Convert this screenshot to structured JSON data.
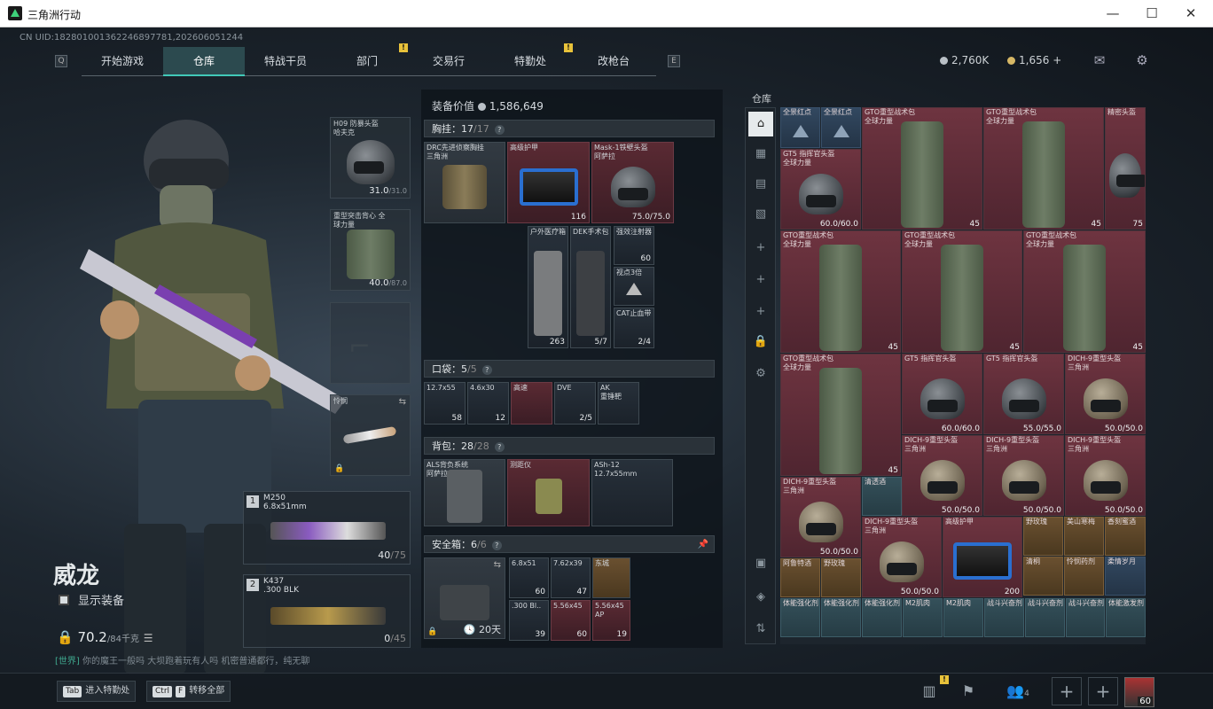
{
  "window": {
    "title": "三角洲行动",
    "minimize": "—",
    "maximize": "☐",
    "close": "✕"
  },
  "uid": "CN UID:1828010013622468977​81,20260605​1244",
  "nav": {
    "key_left": "Q",
    "key_right": "E",
    "tabs": [
      "开始游戏",
      "仓库",
      "特战干员",
      "部门",
      "交易行",
      "特勤处",
      "改枪台"
    ],
    "active": "仓库"
  },
  "currency": {
    "silver": "2,760K",
    "silver_color": "#b9c0c6",
    "gold": "1,656",
    "gold_plus": "+",
    "gold_color": "#d7b866"
  },
  "operator": {
    "name": "威龙",
    "show_equipment": "显示装备",
    "weight": "70.2",
    "weight_max": "/84千克"
  },
  "chat": {
    "channel": "[世界]",
    "text": "你的魔王一般吗 大坝跑着玩有人吗 机密普通都行，纯无聊"
  },
  "gear": {
    "helmet": {
      "label": "H09 防暴头盔 哈夫克",
      "durability": "31.0",
      "max": "/31.0"
    },
    "armor": {
      "label": "重型突击背心 全球力量",
      "durability": "40.0",
      "max": "/87.0"
    },
    "melee": {
      "label": "怜悯"
    },
    "primary": {
      "num": "1",
      "name": "M250",
      "caliber": "6.8x51mm",
      "ammo": "40",
      "ammo_max": "/75"
    },
    "secondary": {
      "num": "2",
      "name": "K437",
      "caliber": ".300 BLK",
      "ammo": "0",
      "ammo_max": "/45"
    }
  },
  "mid": {
    "value_label": "装备价值",
    "value": "1,586,649",
    "rig": {
      "label": "胸挂：",
      "count": "17",
      "max": "/17"
    },
    "pocket": {
      "label": "口袋：",
      "count": "5",
      "max": "/5"
    },
    "backpack": {
      "label": "背包：",
      "count": "28",
      "max": "/28"
    },
    "safe": {
      "label": "安全箱：",
      "count": "6",
      "max": "/6",
      "timer": "20天"
    },
    "rig_items": [
      {
        "label": "DRC先进侦察胸挂\n三角洲",
        "value": ""
      },
      {
        "label": "高级护甲",
        "value": "116"
      },
      {
        "label": "Mask-1铁壁头盔\n阿萨拉",
        "value": "75.0/75.0"
      },
      {
        "label": "户外医疗箱",
        "value": "263"
      },
      {
        "label": "DEK手术包",
        "value": "5/7"
      },
      {
        "label": "强效注射器",
        "value": "60"
      },
      {
        "label": "视点3倍",
        "value": ""
      },
      {
        "label": "CAT止血带",
        "value": "2/4"
      }
    ],
    "pocket_items": [
      {
        "label": "12.7x55",
        "value": "58"
      },
      {
        "label": "4.6x30",
        "value": "12"
      },
      {
        "label": "高速",
        "value": ""
      },
      {
        "label": "DVE",
        "value": "2/5"
      },
      {
        "label": "AK\n重锤靶",
        "value": ""
      }
    ],
    "backpack_items": [
      {
        "label": "ALS背负系统\n阿萨拉",
        "value": ""
      },
      {
        "label": "测距仪",
        "value": ""
      },
      {
        "label": "ASh-12\n12.7x55mm",
        "value": ""
      }
    ],
    "safe_items": [
      {
        "label": "6.8x51",
        "value": "60"
      },
      {
        "label": "7.62x39",
        "value": "47"
      },
      {
        "label": "东城",
        "value": ""
      },
      {
        "label": ".300 Bl..",
        "value": "39"
      },
      {
        "label": "5.56x45",
        "value": "60"
      },
      {
        "label": "5.56x45\nAP",
        "value": "19"
      }
    ]
  },
  "storage": {
    "title": "仓库",
    "sidebar": [
      "home-icon",
      "grid-icon",
      "box-icon",
      "gallery-icon",
      "plus-icon",
      "plus-icon",
      "plus-icon",
      "lock-icon",
      "gear-icon",
      "archive-icon",
      "layers-icon",
      "sort-icon"
    ],
    "items": [
      {
        "label": "全景红点",
        "value": ""
      },
      {
        "label": "全景红点",
        "value": ""
      },
      {
        "label": "GTO重型战术包\n全球力量",
        "value": "45"
      },
      {
        "label": "GTO重型战术包\n全球力量",
        "value": "45"
      },
      {
        "label": "精密头盔",
        "value": "75"
      },
      {
        "label": "GT5 指挥官头盔\n全球力量",
        "value": "60.0/60.0"
      },
      {
        "label": "GTO重型战术包\n全球力量",
        "value": "45"
      },
      {
        "label": "GTO重型战术包\n全球力量",
        "value": "45"
      },
      {
        "label": "GTO重型战术包\n全球力量",
        "value": "45"
      },
      {
        "label": "GTO重型战术包\n全球力量",
        "value": "45"
      },
      {
        "label": "GT5 指挥官头盔",
        "value": "60.0/60.0"
      },
      {
        "label": "GT5 指挥官头盔",
        "value": "55.0/55.0"
      },
      {
        "label": "DICH-9重型头盔\n三角洲",
        "value": "50.0/50.0"
      },
      {
        "label": "DICH-9重型头盔\n三角洲",
        "value": "50.0/50.0"
      },
      {
        "label": "DICH-9重型头盔\n三角洲",
        "value": "50.0/50.0"
      },
      {
        "label": "DICH-9重型头盔\n三角洲",
        "value": "50.0/50.0"
      },
      {
        "label": "DICH-9重型头盔\n三角洲",
        "value": "50.0/50.0"
      },
      {
        "label": "清透酒",
        "value": ""
      },
      {
        "label": "DICH-9重型头盔\n三角洲",
        "value": "50.0/50.0"
      },
      {
        "label": "高级护甲",
        "value": "200"
      },
      {
        "label": "野玫瑰",
        "value": ""
      },
      {
        "label": "美山寒梅",
        "value": ""
      },
      {
        "label": "香刻蜜酒",
        "value": ""
      },
      {
        "label": "阿鲁特酒",
        "value": ""
      },
      {
        "label": "野玫瑰",
        "value": ""
      },
      {
        "label": "清桐",
        "value": ""
      },
      {
        "label": "怜悯药剂",
        "value": ""
      },
      {
        "label": "柔情岁月",
        "value": ""
      },
      {
        "label": "体能强化剂",
        "value": ""
      },
      {
        "label": "体能强化剂",
        "value": ""
      },
      {
        "label": "体能强化剂",
        "value": ""
      },
      {
        "label": "M2肌肉",
        "value": ""
      },
      {
        "label": "M2肌肉",
        "value": ""
      },
      {
        "label": "战斗兴奋剂",
        "value": ""
      },
      {
        "label": "战斗兴奋剂",
        "value": ""
      },
      {
        "label": "战斗兴奋剂",
        "value": ""
      },
      {
        "label": "体能激发剂",
        "value": ""
      }
    ]
  },
  "bottom": {
    "tab_key": "Tab",
    "tab_label": "进入特勤处",
    "ctrl_key": "Ctrl",
    "f_key": "F",
    "transfer_label": "转移全部",
    "squad_count": "4",
    "level": "60"
  }
}
